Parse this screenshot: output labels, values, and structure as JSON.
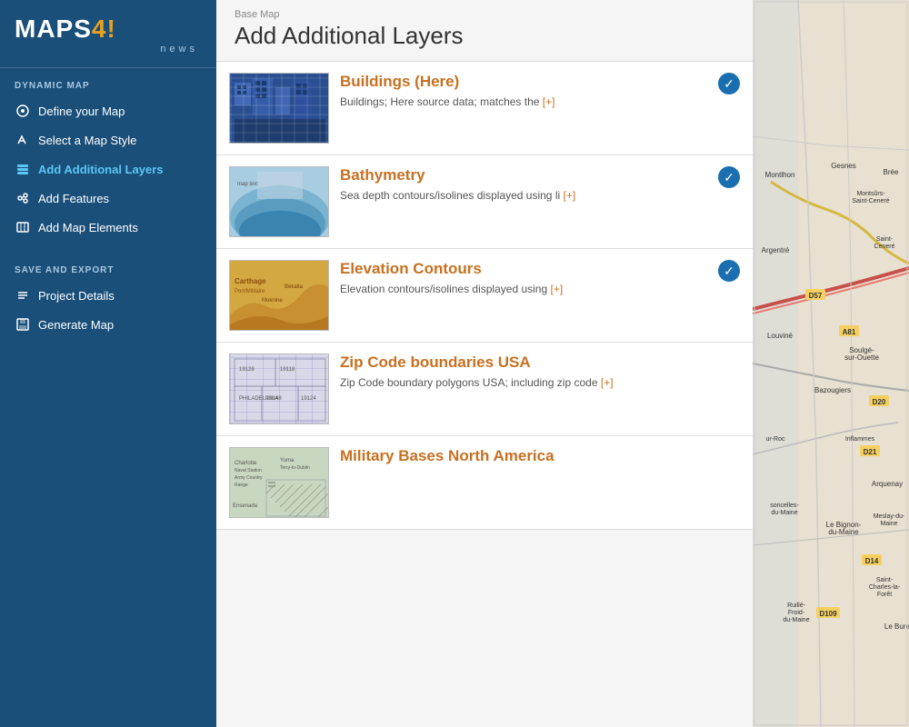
{
  "sidebar": {
    "logo": {
      "maps": "MAPS",
      "four": "4",
      "excl": "!",
      "sub": "news"
    },
    "dynamic_map_label": "DYNAMIC MAP",
    "nav_items": [
      {
        "id": "define-map",
        "label": "Define your Map",
        "icon": "cursor-icon",
        "active": false
      },
      {
        "id": "select-style",
        "label": "Select a Map Style",
        "icon": "paint-icon",
        "active": false
      },
      {
        "id": "add-layers",
        "label": "Add Additional Layers",
        "icon": "layers-icon",
        "active": true
      },
      {
        "id": "add-features",
        "label": "Add Features",
        "icon": "star-icon",
        "active": false
      },
      {
        "id": "add-elements",
        "label": "Add Map Elements",
        "icon": "map-icon",
        "active": false
      }
    ],
    "save_export_label": "SAVE AND EXPORT",
    "save_items": [
      {
        "id": "project-details",
        "label": "Project Details",
        "icon": "list-icon"
      },
      {
        "id": "generate-map",
        "label": "Generate Map",
        "icon": "save-icon"
      }
    ]
  },
  "main": {
    "breadcrumb": "Base Map",
    "page_title": "Add Additional Layers",
    "layers": [
      {
        "id": "buildings",
        "title": "Buildings (Here)",
        "description": "Buildings; Here source data; matches the",
        "more": "[+]",
        "checked": true,
        "thumb_type": "buildings"
      },
      {
        "id": "bathymetry",
        "title": "Bathymetry",
        "description": "Sea depth contours/isolines displayed using li",
        "more": "[+]",
        "checked": true,
        "thumb_type": "bathymetry"
      },
      {
        "id": "elevation",
        "title": "Elevation Contours",
        "description": "Elevation contours/isolines displayed using",
        "more": "[+]",
        "checked": true,
        "thumb_type": "elevation"
      },
      {
        "id": "zipcode",
        "title": "Zip Code boundaries USA",
        "description": "Zip Code boundary polygons USA; including zip code",
        "more": "[+]",
        "checked": false,
        "thumb_type": "zipcode"
      },
      {
        "id": "military",
        "title": "Military Bases North America",
        "description": "",
        "more": "",
        "checked": false,
        "thumb_type": "military"
      }
    ]
  }
}
